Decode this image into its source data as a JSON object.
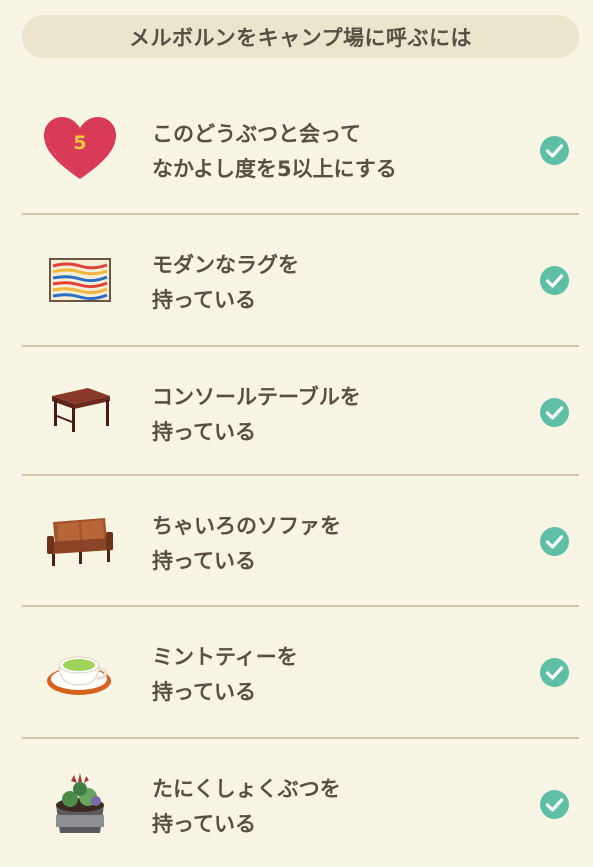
{
  "header": {
    "title": "メルボルンをキャンプ場に呼ぶには"
  },
  "conditions": [
    {
      "icon": "heart-friendship-icon",
      "badge": "5",
      "line1": "このどうぶつと会って",
      "line2": "なかよし度を5以上にする",
      "completed": true
    },
    {
      "icon": "modern-rug-icon",
      "line1": "モダンなラグを",
      "line2": "持っている",
      "completed": true
    },
    {
      "icon": "console-table-icon",
      "line1": "コンソールテーブルを",
      "line2": "持っている",
      "completed": true
    },
    {
      "icon": "brown-sofa-icon",
      "line1": "ちゃいろのソファを",
      "line2": "持っている",
      "completed": true
    },
    {
      "icon": "mint-tea-icon",
      "line1": "ミントティーを",
      "line2": "持っている",
      "completed": true
    },
    {
      "icon": "succulent-plant-icon",
      "line1": "たにくしょくぶつを",
      "line2": "持っている",
      "completed": true
    }
  ],
  "colors": {
    "background": "#f8f5e4",
    "header": "#ece4cc",
    "check": "#5fbfa6",
    "heart": "#d93a55",
    "text": "#5a4f45"
  }
}
